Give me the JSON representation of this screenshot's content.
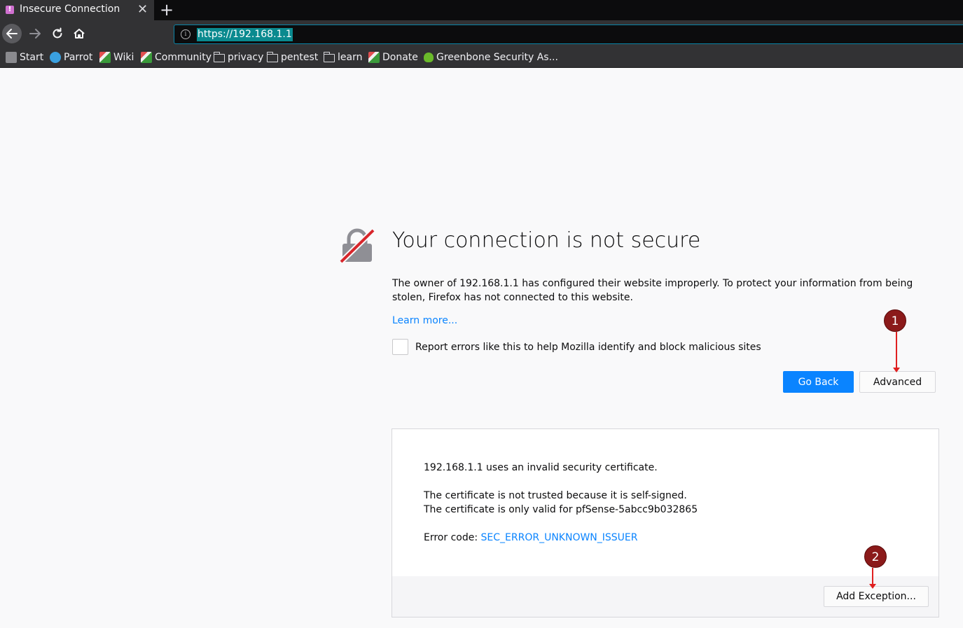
{
  "tab": {
    "title": "Insecure Connection",
    "favicon": "!",
    "close": "✕",
    "new": "+"
  },
  "nav": {
    "url": "https://192.168.1.1"
  },
  "bookmarks": [
    {
      "label": "Start",
      "icon": "start-icon"
    },
    {
      "label": "Parrot",
      "icon": "parrot-icon"
    },
    {
      "label": "Wiki",
      "icon": "leaf-icon"
    },
    {
      "label": "Community",
      "icon": "leaf-icon"
    },
    {
      "label": "privacy",
      "icon": "folder-icon"
    },
    {
      "label": "pentest",
      "icon": "folder-icon"
    },
    {
      "label": "learn",
      "icon": "folder-icon"
    },
    {
      "label": "Donate",
      "icon": "leaf-icon"
    },
    {
      "label": "Greenbone Security As...",
      "icon": "greenbone-icon"
    }
  ],
  "error": {
    "title": "Your connection is not secure",
    "description": "The owner of 192.168.1.1 has configured their website improperly. To protect your information from being stolen, Firefox has not connected to this website.",
    "learn_more": "Learn more...",
    "report_label": "Report errors like this to help Mozilla identify and block malicious sites",
    "go_back": "Go Back",
    "advanced": "Advanced"
  },
  "advanced_panel": {
    "line1": "192.168.1.1 uses an invalid security certificate.",
    "line2": "The certificate is not trusted because it is self-signed.",
    "line3": "The certificate is only valid for pfSense-5abcc9b032865",
    "error_code_label": "Error code: ",
    "error_code": "SEC_ERROR_UNKNOWN_ISSUER",
    "add_exception": "Add Exception..."
  },
  "annotations": {
    "marker1": "1",
    "marker2": "2"
  },
  "colors": {
    "accent": "#0a84ff",
    "marker": "#8b1a1a",
    "arrow": "#e02020",
    "url_highlight": "#0a8a8f"
  }
}
